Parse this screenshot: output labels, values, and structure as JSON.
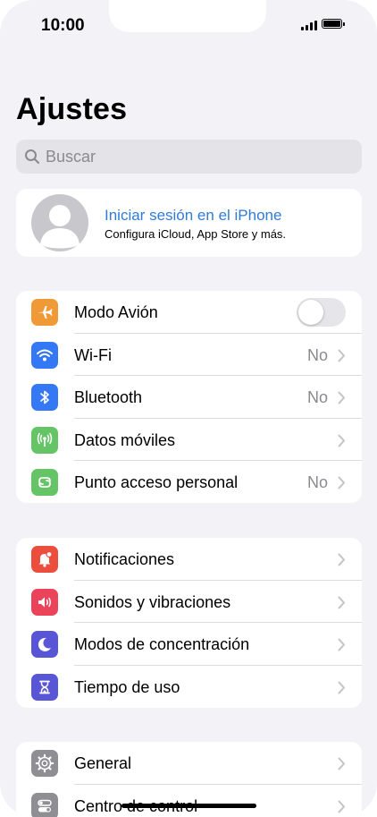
{
  "status_bar": {
    "time": "10:00"
  },
  "header": {
    "title": "Ajustes"
  },
  "search": {
    "placeholder": "Buscar"
  },
  "profile": {
    "title": "Iniciar sesión en el iPhone",
    "subtitle": "Configura iCloud, App Store y más."
  },
  "group1": [
    {
      "label": "Modo Avión",
      "value": "",
      "icon": "airplane-icon",
      "color": "#f09a37",
      "control": "toggle",
      "toggle_on": false
    },
    {
      "label": "Wi-Fi",
      "value": "No",
      "icon": "wifi-icon",
      "color": "#3478f6",
      "control": "chevron"
    },
    {
      "label": "Bluetooth",
      "value": "No",
      "icon": "bluetooth-icon",
      "color": "#3478f6",
      "control": "chevron"
    },
    {
      "label": "Datos móviles",
      "value": "",
      "icon": "antenna-icon",
      "color": "#65c466",
      "control": "chevron"
    },
    {
      "label": "Punto acceso personal",
      "value": "No",
      "icon": "hotspot-icon",
      "color": "#65c466",
      "control": "chevron"
    }
  ],
  "group2": [
    {
      "label": "Notificaciones",
      "icon": "bell-icon",
      "color": "#eb4e3d"
    },
    {
      "label": "Sonidos y vibraciones",
      "icon": "speaker-icon",
      "color": "#eb445a"
    },
    {
      "label": "Modos de concentración",
      "icon": "moon-icon",
      "color": "#5856d6"
    },
    {
      "label": "Tiempo de uso",
      "icon": "hourglass-icon",
      "color": "#5856d6"
    }
  ],
  "group3": [
    {
      "label": "General",
      "icon": "gear-icon",
      "color": "#8e8e93"
    },
    {
      "label": "Centro de control",
      "icon": "switches-icon",
      "color": "#8e8e93"
    }
  ]
}
